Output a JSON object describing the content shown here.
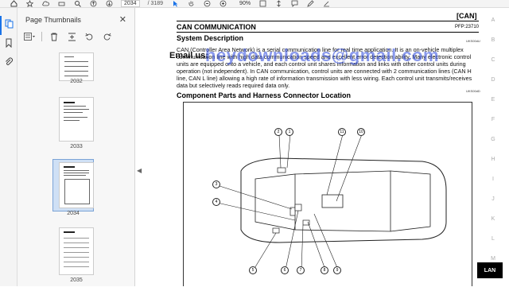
{
  "toolbar": {
    "page_input": "2034",
    "page_total": "/ 3189",
    "zoom": "90%",
    "icons": [
      "home-icon",
      "star-icon",
      "cloud-upload-icon",
      "print-icon",
      "search-icon",
      "up-icon",
      "down-icon",
      "cursor-icon",
      "hand-icon",
      "zoom-out-icon",
      "zoom-in-icon",
      "fit-icon",
      "scroll-icon",
      "comment-icon",
      "pen-icon",
      "highlight-icon"
    ]
  },
  "rail": {
    "icons": [
      "thumbnails-icon",
      "bookmark-icon",
      "attachment-icon"
    ]
  },
  "panel": {
    "title": "Page Thumbnails",
    "close_glyph": "✕",
    "thumbnails": [
      {
        "label": "2032",
        "selected": false
      },
      {
        "label": "2033",
        "selected": false
      },
      {
        "label": "2034",
        "selected": true
      },
      {
        "label": "2035",
        "selected": false
      }
    ]
  },
  "document": {
    "section_tag": "[CAN]",
    "title": "CAN COMMUNICATION",
    "pfp": "PFP:23710",
    "system_heading": "System Description",
    "code_a": "UKS00dU",
    "para1": "CAN (Controller Area Network) is a serial communication line for real time application. It is an on-vehicle multiplex communication line with high data communication speed and excellent error detection ability. Many electronic control units are equipped onto a vehicle, and each control unit shares information and links with other control units during operation (not independent). In CAN communication, control units are connected with 2 communication lines (CAN H line, CAN L line) allowing a high rate of information transmission with less wiring. Each control unit transmits/receives data but selectively reads required data only.",
    "code_b": "UKS00dD",
    "components_heading": "Component Parts and Harness Connector Location",
    "watermark_label": "Email us:",
    "watermark": "heydownloads@gmail.com"
  },
  "diagram_callouts": [
    "1",
    "2",
    "3",
    "4",
    "5",
    "6",
    "7",
    "8",
    "9",
    "10",
    "11"
  ],
  "index": {
    "letters": [
      "A",
      "B",
      "C",
      "D",
      "E",
      "F",
      "G",
      "H",
      "I",
      "J",
      "K",
      "L",
      "M"
    ],
    "active": "LAN"
  },
  "colors": {
    "accent": "#1a73e8",
    "watermark": "#2846dc"
  }
}
